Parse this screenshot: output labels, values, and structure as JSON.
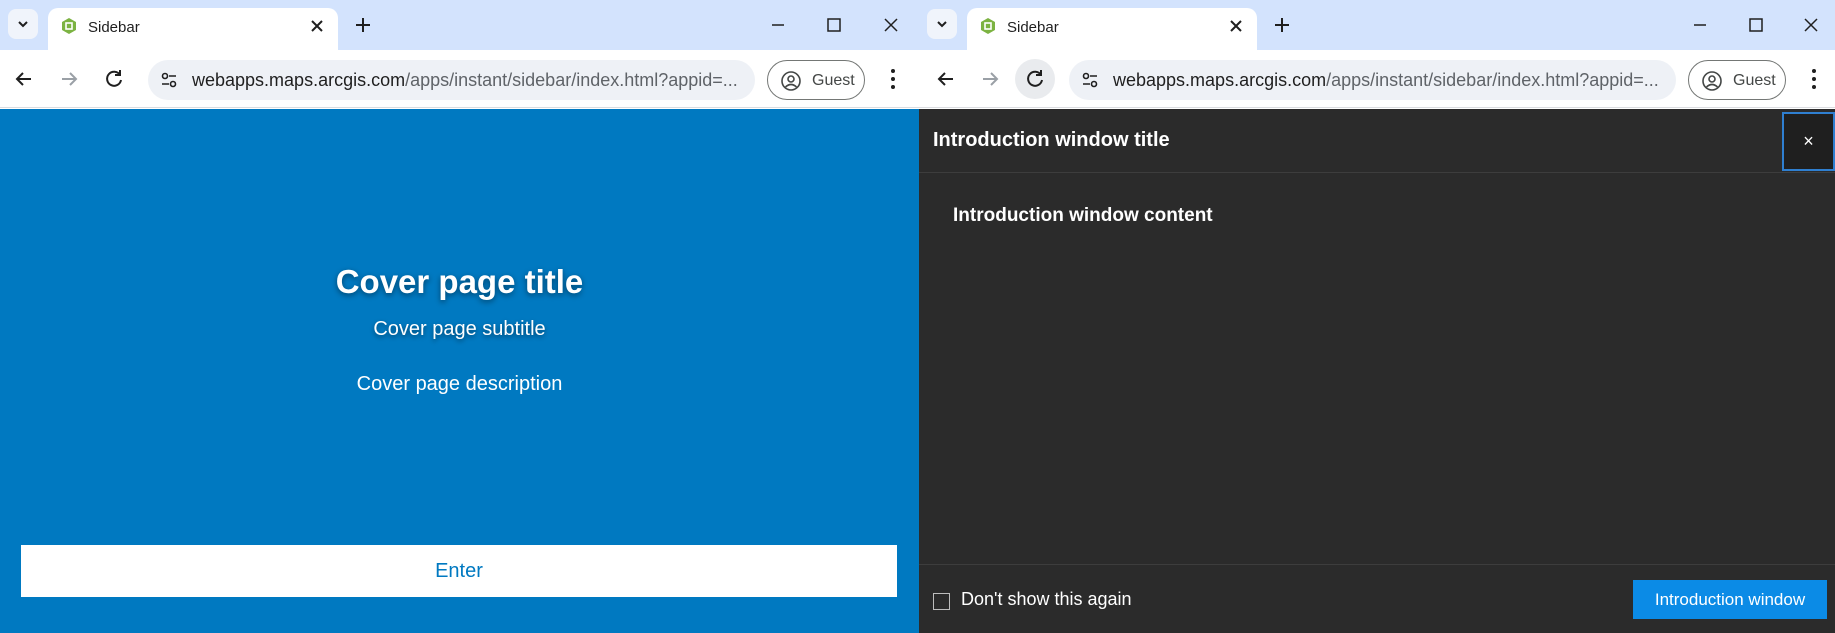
{
  "left_window": {
    "tab": {
      "title": "Sidebar"
    },
    "address": {
      "host": "webapps.maps.arcgis.com",
      "path": "/apps/instant/sidebar/index.html?appid=..."
    },
    "profile": {
      "label": "Guest"
    },
    "cover": {
      "title": "Cover page title",
      "subtitle": "Cover page subtitle",
      "description": "Cover page description",
      "enter_label": "Enter"
    }
  },
  "right_window": {
    "tab": {
      "title": "Sidebar"
    },
    "address": {
      "host": "webapps.maps.arcgis.com",
      "path": "/apps/instant/sidebar/index.html?appid=..."
    },
    "profile": {
      "label": "Guest"
    },
    "modal": {
      "title": "Introduction window title",
      "content": "Introduction window content",
      "close_symbol": "×",
      "checkbox_label": "Don't show this again",
      "checkbox_checked": false,
      "button_label": "Introduction window"
    }
  },
  "colors": {
    "tabstrip": "#d3e3fd",
    "cover_bg": "#0079c1",
    "modal_bg": "#2b2b2b",
    "primary_button": "#0b8be6",
    "favicon": "#7cb342"
  },
  "icons": [
    "tab-search-icon",
    "arcgis-favicon",
    "close-icon",
    "plus-icon",
    "minimize-icon",
    "maximize-icon",
    "window-close-icon",
    "back-arrow-icon",
    "forward-arrow-icon",
    "reload-icon",
    "site-settings-icon",
    "profile-icon",
    "kebab-menu-icon"
  ]
}
